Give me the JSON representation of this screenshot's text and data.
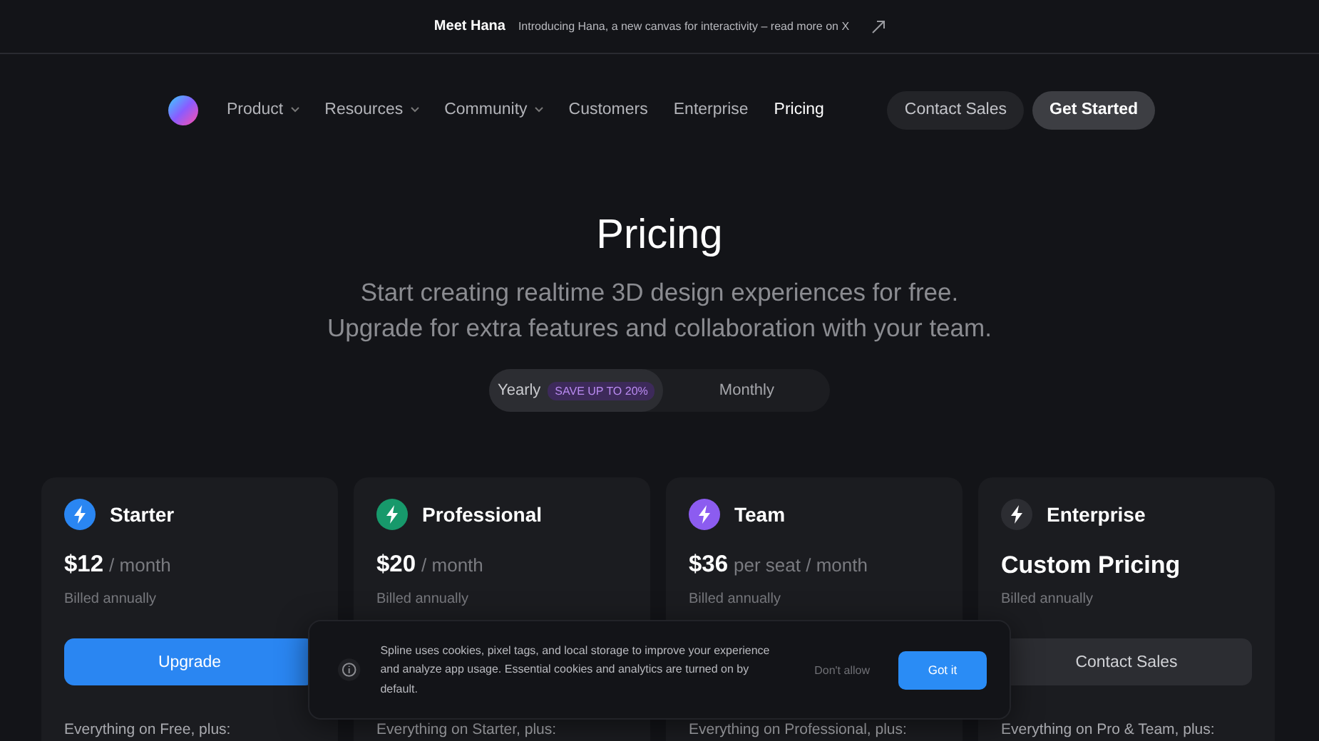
{
  "announcement": {
    "title": "Meet Hana",
    "text": "Introducing Hana, a new canvas for interactivity – read more on X"
  },
  "nav": {
    "items": [
      {
        "label": "Product",
        "dropdown": true,
        "selected": false
      },
      {
        "label": "Resources",
        "dropdown": true,
        "selected": false
      },
      {
        "label": "Community",
        "dropdown": true,
        "selected": false
      },
      {
        "label": "Customers",
        "dropdown": false,
        "selected": false
      },
      {
        "label": "Enterprise",
        "dropdown": false,
        "selected": false
      },
      {
        "label": "Pricing",
        "dropdown": false,
        "selected": true
      }
    ],
    "buttons": [
      {
        "label": "Contact Sales",
        "kind": "secondary"
      },
      {
        "label": "Get Started",
        "kind": "primary"
      }
    ]
  },
  "hero": {
    "title": "Pricing",
    "subtitle_lines": [
      "Start creating realtime 3D design experiences for free.",
      "Upgrade for extra features and collaboration with your team."
    ]
  },
  "billing_toggle": [
    {
      "label": "Yearly",
      "badge": "SAVE UP TO 20%",
      "selected": true
    },
    {
      "label": "Monthly",
      "selected": false
    }
  ],
  "plans": [
    {
      "name": "Starter",
      "color": "#2a86f2",
      "price": "$12",
      "period": "/ month",
      "billing": "Billed annually",
      "button": {
        "label": "Upgrade",
        "kind": "primary"
      },
      "features_intro": "Everything on Free, plus:"
    },
    {
      "name": "Professional",
      "color": "#17996b",
      "price": "$20",
      "period": "/ month",
      "billing": "Billed annually",
      "features_intro": "Everything on Starter, plus:"
    },
    {
      "name": "Team",
      "color": "#8c5cf0",
      "price": "$36",
      "period": "per seat / month",
      "billing": "Billed annually",
      "features_intro": "Everything on Professional, plus:"
    },
    {
      "name": "Enterprise",
      "color": "#2c2d32",
      "price": "Custom Pricing",
      "billing": "Billed annually",
      "button": {
        "label": "Contact Sales",
        "kind": "secondary"
      },
      "features_intro": "Everything on Pro & Team, plus:"
    }
  ],
  "cookie_banner": {
    "text": "Spline uses cookies, pixel tags, and local storage to improve your experience and analyze app usage. Essential cookies and analytics are turned on by default.",
    "decline": "Don't allow",
    "accept": "Got it"
  }
}
